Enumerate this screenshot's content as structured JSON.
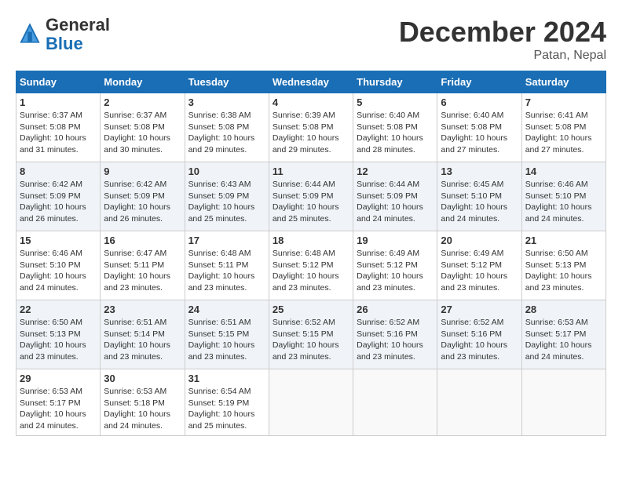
{
  "logo": {
    "general": "General",
    "blue": "Blue"
  },
  "header": {
    "month": "December 2024",
    "location": "Patan, Nepal"
  },
  "weekdays": [
    "Sunday",
    "Monday",
    "Tuesday",
    "Wednesday",
    "Thursday",
    "Friday",
    "Saturday"
  ],
  "weeks": [
    [
      {
        "day": "1",
        "sunrise": "6:37 AM",
        "sunset": "5:08 PM",
        "daylight": "10 hours and 31 minutes."
      },
      {
        "day": "2",
        "sunrise": "6:37 AM",
        "sunset": "5:08 PM",
        "daylight": "10 hours and 30 minutes."
      },
      {
        "day": "3",
        "sunrise": "6:38 AM",
        "sunset": "5:08 PM",
        "daylight": "10 hours and 29 minutes."
      },
      {
        "day": "4",
        "sunrise": "6:39 AM",
        "sunset": "5:08 PM",
        "daylight": "10 hours and 29 minutes."
      },
      {
        "day": "5",
        "sunrise": "6:40 AM",
        "sunset": "5:08 PM",
        "daylight": "10 hours and 28 minutes."
      },
      {
        "day": "6",
        "sunrise": "6:40 AM",
        "sunset": "5:08 PM",
        "daylight": "10 hours and 27 minutes."
      },
      {
        "day": "7",
        "sunrise": "6:41 AM",
        "sunset": "5:08 PM",
        "daylight": "10 hours and 27 minutes."
      }
    ],
    [
      {
        "day": "8",
        "sunrise": "6:42 AM",
        "sunset": "5:09 PM",
        "daylight": "10 hours and 26 minutes."
      },
      {
        "day": "9",
        "sunrise": "6:42 AM",
        "sunset": "5:09 PM",
        "daylight": "10 hours and 26 minutes."
      },
      {
        "day": "10",
        "sunrise": "6:43 AM",
        "sunset": "5:09 PM",
        "daylight": "10 hours and 25 minutes."
      },
      {
        "day": "11",
        "sunrise": "6:44 AM",
        "sunset": "5:09 PM",
        "daylight": "10 hours and 25 minutes."
      },
      {
        "day": "12",
        "sunrise": "6:44 AM",
        "sunset": "5:09 PM",
        "daylight": "10 hours and 24 minutes."
      },
      {
        "day": "13",
        "sunrise": "6:45 AM",
        "sunset": "5:10 PM",
        "daylight": "10 hours and 24 minutes."
      },
      {
        "day": "14",
        "sunrise": "6:46 AM",
        "sunset": "5:10 PM",
        "daylight": "10 hours and 24 minutes."
      }
    ],
    [
      {
        "day": "15",
        "sunrise": "6:46 AM",
        "sunset": "5:10 PM",
        "daylight": "10 hours and 24 minutes."
      },
      {
        "day": "16",
        "sunrise": "6:47 AM",
        "sunset": "5:11 PM",
        "daylight": "10 hours and 23 minutes."
      },
      {
        "day": "17",
        "sunrise": "6:48 AM",
        "sunset": "5:11 PM",
        "daylight": "10 hours and 23 minutes."
      },
      {
        "day": "18",
        "sunrise": "6:48 AM",
        "sunset": "5:12 PM",
        "daylight": "10 hours and 23 minutes."
      },
      {
        "day": "19",
        "sunrise": "6:49 AM",
        "sunset": "5:12 PM",
        "daylight": "10 hours and 23 minutes."
      },
      {
        "day": "20",
        "sunrise": "6:49 AM",
        "sunset": "5:12 PM",
        "daylight": "10 hours and 23 minutes."
      },
      {
        "day": "21",
        "sunrise": "6:50 AM",
        "sunset": "5:13 PM",
        "daylight": "10 hours and 23 minutes."
      }
    ],
    [
      {
        "day": "22",
        "sunrise": "6:50 AM",
        "sunset": "5:13 PM",
        "daylight": "10 hours and 23 minutes."
      },
      {
        "day": "23",
        "sunrise": "6:51 AM",
        "sunset": "5:14 PM",
        "daylight": "10 hours and 23 minutes."
      },
      {
        "day": "24",
        "sunrise": "6:51 AM",
        "sunset": "5:15 PM",
        "daylight": "10 hours and 23 minutes."
      },
      {
        "day": "25",
        "sunrise": "6:52 AM",
        "sunset": "5:15 PM",
        "daylight": "10 hours and 23 minutes."
      },
      {
        "day": "26",
        "sunrise": "6:52 AM",
        "sunset": "5:16 PM",
        "daylight": "10 hours and 23 minutes."
      },
      {
        "day": "27",
        "sunrise": "6:52 AM",
        "sunset": "5:16 PM",
        "daylight": "10 hours and 23 minutes."
      },
      {
        "day": "28",
        "sunrise": "6:53 AM",
        "sunset": "5:17 PM",
        "daylight": "10 hours and 24 minutes."
      }
    ],
    [
      {
        "day": "29",
        "sunrise": "6:53 AM",
        "sunset": "5:17 PM",
        "daylight": "10 hours and 24 minutes."
      },
      {
        "day": "30",
        "sunrise": "6:53 AM",
        "sunset": "5:18 PM",
        "daylight": "10 hours and 24 minutes."
      },
      {
        "day": "31",
        "sunrise": "6:54 AM",
        "sunset": "5:19 PM",
        "daylight": "10 hours and 25 minutes."
      },
      null,
      null,
      null,
      null
    ]
  ]
}
